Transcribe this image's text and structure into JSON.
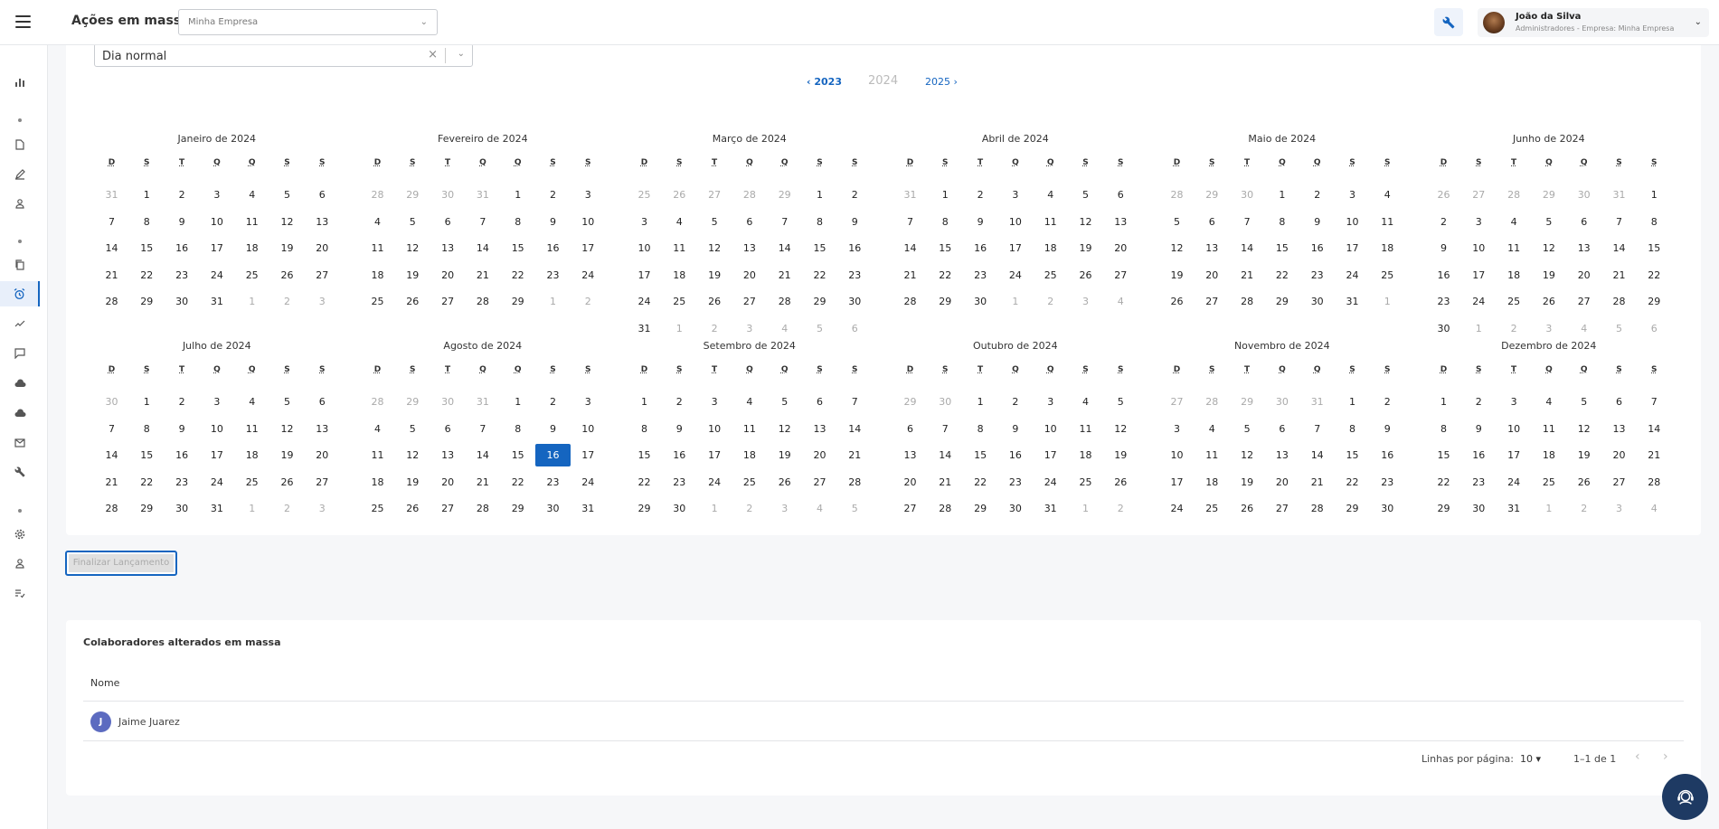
{
  "header": {
    "title": "Ações em massa",
    "company_value": "Minha Empresa",
    "user_name": "João da Silva",
    "user_role": "Administradores - Empresa: Minha Empresa"
  },
  "calendar": {
    "day_type_value": "Dia normal",
    "prev_year": "2023",
    "current_year": "2024",
    "next_year": "2025",
    "weekdays": [
      "D",
      "S",
      "T",
      "Q",
      "Q",
      "S",
      "S"
    ],
    "selected": {
      "month": 7,
      "day": 16
    },
    "months": [
      {
        "name": "Janeiro de 2024",
        "prev_tail": [
          31
        ],
        "days": 31,
        "next_head": [
          1,
          2,
          3
        ]
      },
      {
        "name": "Fevereiro de 2024",
        "prev_tail": [
          28,
          29,
          30,
          31
        ],
        "days": 29,
        "next_head": [
          1,
          2
        ]
      },
      {
        "name": "Março de 2024",
        "prev_tail": [
          25,
          26,
          27,
          28,
          29
        ],
        "days": 31,
        "next_head": [
          1,
          2,
          3,
          4,
          5,
          6
        ]
      },
      {
        "name": "Abril de 2024",
        "prev_tail": [
          31
        ],
        "days": 30,
        "next_head": [
          1,
          2,
          3,
          4
        ]
      },
      {
        "name": "Maio de 2024",
        "prev_tail": [
          28,
          29,
          30
        ],
        "days": 31,
        "next_head": [
          1
        ]
      },
      {
        "name": "Junho de 2024",
        "prev_tail": [
          26,
          27,
          28,
          29,
          30,
          31
        ],
        "days": 30,
        "next_head": [
          1,
          2,
          3,
          4,
          5,
          6
        ]
      },
      {
        "name": "Julho de 2024",
        "prev_tail": [
          30
        ],
        "days": 31,
        "next_head": [
          1,
          2,
          3
        ]
      },
      {
        "name": "Agosto de 2024",
        "prev_tail": [
          28,
          29,
          30,
          31
        ],
        "days": 31,
        "next_head": []
      },
      {
        "name": "Setembro de 2024",
        "prev_tail": [],
        "days": 30,
        "next_head": [
          1,
          2,
          3,
          4,
          5
        ]
      },
      {
        "name": "Outubro de 2024",
        "prev_tail": [
          29,
          30
        ],
        "days": 31,
        "next_head": [
          1,
          2
        ]
      },
      {
        "name": "Novembro de 2024",
        "prev_tail": [
          27,
          28,
          29,
          30,
          31
        ],
        "days": 30,
        "next_head": []
      },
      {
        "name": "Dezembro de 2024",
        "prev_tail": [],
        "days": 31,
        "next_head": [
          1,
          2,
          3,
          4
        ]
      }
    ]
  },
  "actions": {
    "finish_label": "Finalizar Lançamento"
  },
  "list": {
    "title": "Colaboradores alterados em massa",
    "column_name": "Nome",
    "rows": [
      {
        "initial": "J",
        "name": "Jaime Juarez"
      }
    ],
    "rows_per_page_label": "Linhas por página:",
    "rows_per_page_value": "10",
    "range": "1–1 de 1"
  },
  "colors": {
    "accent": "#1565c0",
    "avatar": "#5c6bc0",
    "fab": "#1e3a63"
  },
  "icons": {
    "sidebar": [
      "bar-chart-icon",
      "file-icon",
      "edit-icon",
      "user-icon",
      "copy-icon",
      "alarm-icon",
      "trend-icon",
      "chat-icon",
      "cloud-upload-icon",
      "cloud-download-icon",
      "mail-icon",
      "wrench-icon",
      "gear-icon",
      "user-icon",
      "checklist-icon"
    ]
  }
}
